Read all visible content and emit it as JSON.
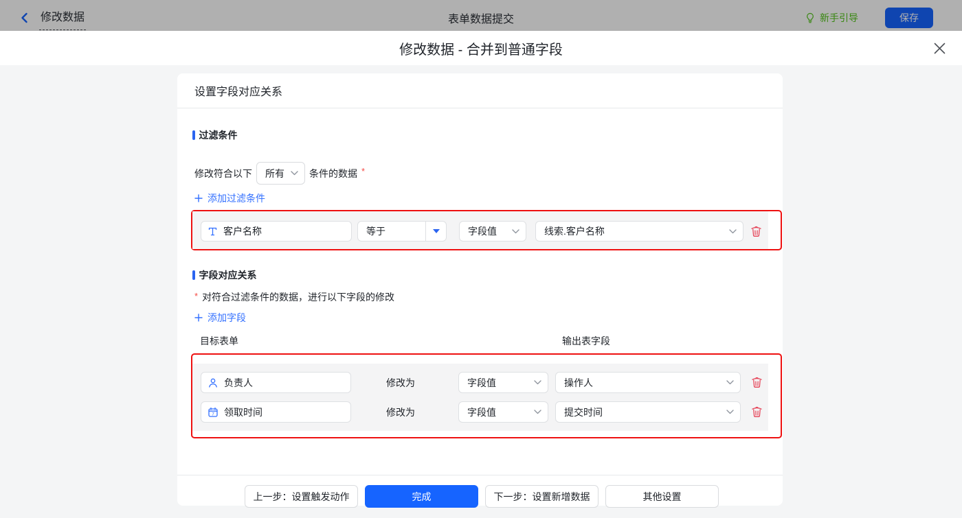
{
  "topbar": {
    "back_label": "修改数据",
    "app_title": "表单数据提交",
    "guide_label": "新手引导",
    "save_label": "保存"
  },
  "modal": {
    "title": "修改数据 - 合并到普通字段"
  },
  "card": {
    "header": "设置字段对应关系",
    "filter_section": {
      "title": "过滤条件",
      "match_prefix": "修改符合以下",
      "match_select_value": "所有",
      "match_suffix": "条件的数据",
      "required_mark": "*",
      "add_label": "添加过滤条件",
      "row": {
        "field": "客户名称",
        "field_icon": "text-field-icon",
        "operator": "等于",
        "value_type": "字段值",
        "value": "线索.客户名称"
      }
    },
    "mapping_section": {
      "title": "字段对应关系",
      "required_mark": "*",
      "desc": "对符合过滤条件的数据，进行以下字段的修改",
      "add_label": "添加字段",
      "col_left": "目标表单",
      "col_right": "输出表字段",
      "rows": [
        {
          "field": "负责人",
          "field_icon": "person-icon",
          "modify_label": "修改为",
          "value_type": "字段值",
          "value": "操作人"
        },
        {
          "field": "领取时间",
          "field_icon": "calendar-icon",
          "modify_label": "修改为",
          "value_type": "字段值",
          "value": "提交时间"
        }
      ]
    },
    "footer": {
      "prev_label": "上一步：设置触发动作",
      "done_label": "完成",
      "next_label": "下一步：设置新增数据",
      "other_label": "其他设置"
    }
  },
  "colors": {
    "accent_blue": "#1664ff",
    "link_blue": "#3370ff",
    "guide_green": "#52c41a",
    "annotation_red": "#ee1010",
    "danger_red": "#e6465a",
    "required_red": "#f54a45"
  }
}
